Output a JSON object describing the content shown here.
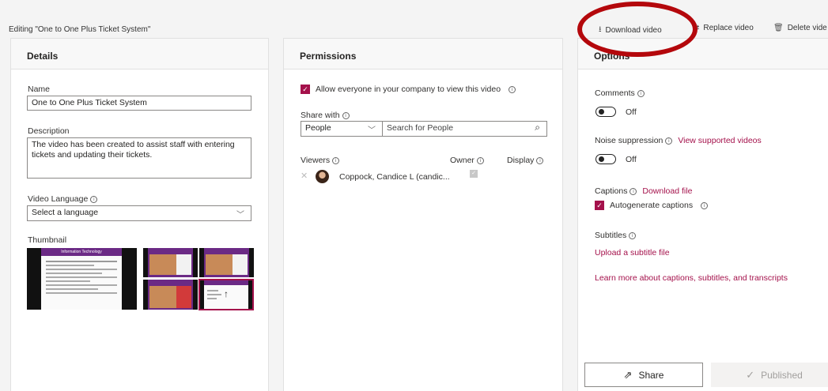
{
  "header": {
    "editing_label": "Editing \"One to One Plus Ticket System\"",
    "download_label": "Download video",
    "replace_label": "Replace video",
    "delete_label": "Delete vide"
  },
  "details": {
    "title": "Details",
    "name_label": "Name",
    "name_value": "One to One Plus Ticket System",
    "description_label": "Description",
    "description_value": "The video has been created to assist staff with entering tickets and updating their tickets.",
    "language_label": "Video Language",
    "language_value": "Select a language",
    "thumbnail_label": "Thumbnail",
    "thumb_caption": "Information Technology"
  },
  "permissions": {
    "title": "Permissions",
    "allow_label": "Allow everyone in your company to view this video",
    "share_with_label": "Share with",
    "share_type": "People",
    "search_placeholder": "Search for People",
    "viewers_label": "Viewers",
    "owner_label": "Owner",
    "display_label": "Display",
    "viewer_name": "Coppock, Candice L (candic..."
  },
  "options": {
    "title": "Options",
    "comments_label": "Comments",
    "comments_state": "Off",
    "noise_label": "Noise suppression",
    "noise_link": "View supported videos",
    "noise_state": "Off",
    "captions_label": "Captions",
    "captions_link": "Download file",
    "autogen_label": "Autogenerate captions",
    "subtitles_label": "Subtitles",
    "upload_link": "Upload a subtitle file",
    "learn_link": "Learn more about captions, subtitles, and transcripts",
    "share_button": "Share",
    "published_button": "Published"
  }
}
